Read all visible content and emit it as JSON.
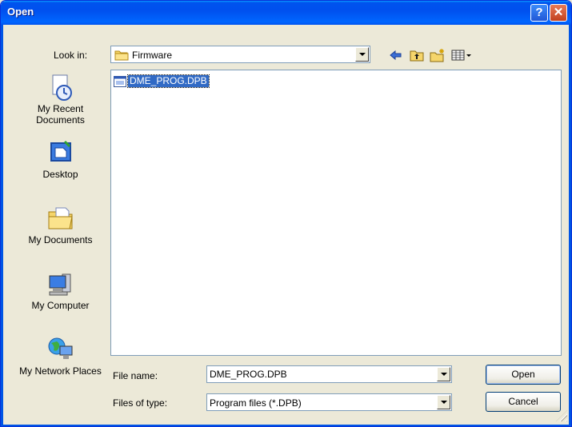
{
  "window": {
    "title": "Open",
    "help_glyph": "?",
    "close_glyph": "✕"
  },
  "look_in": {
    "label": "Look in:",
    "value": "Firmware",
    "icon": "folder-icon"
  },
  "toolbar": {
    "icons": [
      "back-arrow-icon",
      "up-one-level-icon",
      "create-new-folder-icon",
      "view-menu-icon"
    ]
  },
  "places": [
    {
      "label": "My Recent Documents",
      "icon": "recent-documents-icon"
    },
    {
      "label": "Desktop",
      "icon": "desktop-icon"
    },
    {
      "label": "My Documents",
      "icon": "my-documents-icon"
    },
    {
      "label": "My Computer",
      "icon": "my-computer-icon"
    },
    {
      "label": "My Network Places",
      "icon": "network-places-icon"
    }
  ],
  "files": [
    {
      "name": "DME_PROG.DPB",
      "icon": "program-file-icon",
      "selected": true
    }
  ],
  "file_name": {
    "label": "File name:",
    "value": "DME_PROG.DPB"
  },
  "file_type": {
    "label": "Files of type:",
    "value": "Program files (*.DPB)"
  },
  "buttons": {
    "open": "Open",
    "cancel": "Cancel"
  },
  "colors": {
    "titlebar": "#0053ee",
    "selection": "#316ac5",
    "dialog_bg": "#ece9d8"
  }
}
